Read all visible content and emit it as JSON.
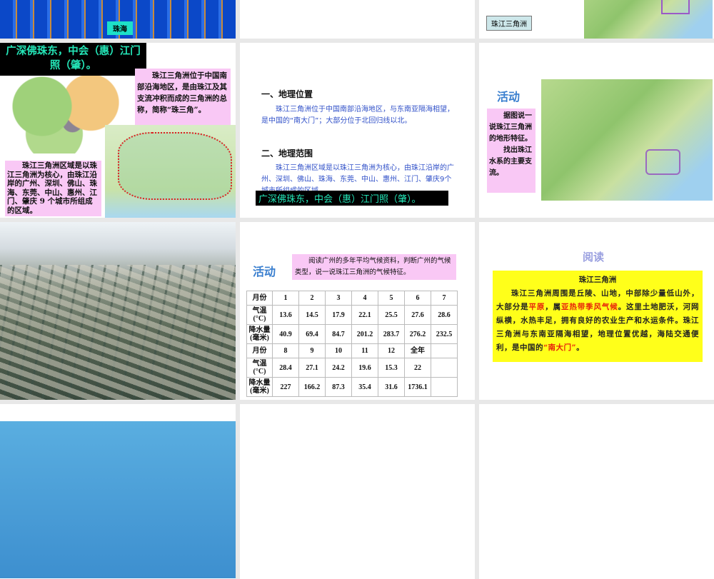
{
  "slide1": {
    "label": "珠海"
  },
  "slide3": {
    "label": "珠江三角洲"
  },
  "slide4": {
    "banner": "广深佛珠东，中会（惠）江门照（肇）。",
    "top_box": "珠江三角洲位于中国南部沿海地区，是由珠江及其支流冲积而成的三角洲的总称，简称“珠三角”。",
    "bottom_box": "珠江三角洲区域是以珠江三角洲为核心，由珠江沿岸的广州、深圳、佛山、珠海、东莞、中山、惠州、江门、肇庆 9 个城市所组成的区域。"
  },
  "slide5": {
    "heading1": "一、地理位置",
    "para1": "珠江三角洲位于中国南部沿海地区，与东南亚隔海相望，是中国的“南大门”；大部分位于北回归线以北。",
    "heading2": "二、地理范围",
    "para2": "珠江三角洲区域是以珠江三角洲为核心，由珠江沿岸的广州、深圳、佛山、珠海、东莞、中山、惠州、江门、肇庆9个城市所组成的区域。",
    "banner": "广深佛珠东，中会（惠）江门照（肇）。"
  },
  "slide6": {
    "title": "活动",
    "box": "据图说一说珠江三角洲的地形特征。找出珠江水系的主要支流。",
    "box_p1": "据图说一说珠江三角洲的地形特征。",
    "box_p2": "找出珠江水系的主要支流。"
  },
  "slide8": {
    "title": "活动",
    "prompt": "阅读广州的多年平均气候资料，判断广州的气候类型，说一说珠江三角洲的气候特征。",
    "table": {
      "rows": [
        [
          "月份",
          "1",
          "2",
          "3",
          "4",
          "5",
          "6",
          "7"
        ],
        [
          "气温(°C)",
          "13.6",
          "14.5",
          "17.9",
          "22.1",
          "25.5",
          "27.6",
          "28.6"
        ],
        [
          "降水量(毫米)",
          "40.9",
          "69.4",
          "84.7",
          "201.2",
          "283.7",
          "276.2",
          "232.5"
        ],
        [
          "月份",
          "8",
          "9",
          "10",
          "11",
          "12",
          "全年",
          ""
        ],
        [
          "气温(°C)",
          "28.4",
          "27.1",
          "24.2",
          "19.6",
          "15.3",
          "22",
          ""
        ],
        [
          "降水量(毫米)",
          "227",
          "166.2",
          "87.3",
          "35.4",
          "31.6",
          "1736.1",
          ""
        ]
      ]
    }
  },
  "slide9": {
    "title": "阅读",
    "box_title": "珠江三角洲",
    "text_a": "珠江三角洲周围是丘陵、山地，中部除少量低山外，大部分是",
    "hl1": "平原",
    "text_b": "，属",
    "hl2": "亚热带季风气候",
    "text_c": "。这里土地肥沃，河网纵横，水热丰足，拥有良好的农业生产和水运条件。珠江三角洲与东南亚隔海相望，地理位置优越，海陆交通便利，是中国的",
    "hl3": "“南大门”",
    "text_d": "。"
  }
}
